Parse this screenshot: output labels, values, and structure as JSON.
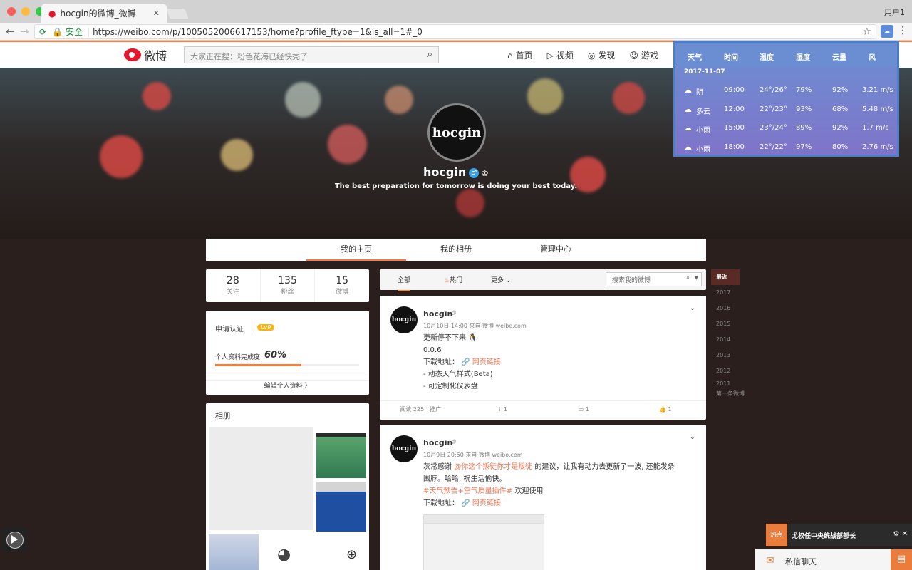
{
  "browser": {
    "tab_title": "hocgin的微博_微博",
    "user": "用户1",
    "secure_label": "安全",
    "url": "https://weibo.com/p/1005052006617153/home?profile_ftype=1&is_all=1#_0"
  },
  "weibo": {
    "logo": "微博",
    "search_placeholder": "大家正在搜：粉色花海已经快秃了",
    "nav": [
      "首页",
      "视频",
      "发现",
      "游戏"
    ]
  },
  "profile": {
    "name": "hocgin",
    "bio": "The best preparation for tomorrow is doing your best today.",
    "avatar_text": "hocgin",
    "tabs": [
      "我的主页",
      "我的相册",
      "管理中心"
    ],
    "stats": [
      {
        "value": "28",
        "label": "关注"
      },
      {
        "value": "135",
        "label": "粉丝"
      },
      {
        "value": "15",
        "label": "微博"
      }
    ],
    "cert_label": "申请认证",
    "level": "Lv9",
    "completeness_label": "个人资料完成度",
    "completeness": "60%",
    "completeness_fraction": 0.6,
    "edit_label": "编辑个人资料 〉",
    "album_title": "相册"
  },
  "feed": {
    "tabs": [
      "全部",
      "热门",
      "更多"
    ],
    "search_placeholder": "搜索我的微博",
    "posts": [
      {
        "author": "hocgin",
        "time": "10月10日 14:00 来自 微博 weibo.com",
        "lines": [
          "更新停不下来",
          "0.0.6",
          "下载地址：",
          "- 动态天气样式(Beta)",
          "- 可定制化仪表盘"
        ],
        "link": "网页链接",
        "actions": [
          "阅读 225",
          "推广",
          "1",
          "1",
          "1"
        ]
      },
      {
        "author": "hocgin",
        "time": "10月9日 20:50 来自 微博 weibo.com",
        "line1_a": "灰常感谢 ",
        "mention": "@你这个叛徒你才是叛徒",
        "line1_b": " 的建议，让我有动力去更新了一波, 还能发条",
        "line2": "围脖。哈哈, 祝生活愉快。",
        "hashtag": "#天气预告+空气质量插件#",
        "line3_b": " 欢迎使用",
        "download": "下载地址：",
        "link": "网页链接"
      }
    ]
  },
  "years": [
    "最近",
    "2017",
    "2016",
    "2015",
    "2014",
    "2013",
    "2012",
    "2011",
    "第一条微博"
  ],
  "weather": {
    "headers": [
      "天气",
      "时间",
      "温度",
      "湿度",
      "云量",
      "风"
    ],
    "date": "2017-11-07",
    "rows": [
      {
        "cond": "阴",
        "time": "09:00",
        "temp": "24°/26°",
        "humidity": "79%",
        "cloud": "92%",
        "wind": "3.21 m/s"
      },
      {
        "cond": "多云",
        "time": "12:00",
        "temp": "22°/23°",
        "humidity": "93%",
        "cloud": "68%",
        "wind": "5.48 m/s"
      },
      {
        "cond": "小雨",
        "time": "15:00",
        "temp": "23°/24°",
        "humidity": "89%",
        "cloud": "92%",
        "wind": "1.7 m/s"
      },
      {
        "cond": "小雨",
        "time": "18:00",
        "temp": "22°/22°",
        "humidity": "97%",
        "cloud": "80%",
        "wind": "2.76 m/s"
      }
    ]
  },
  "hot": {
    "tag": "热点",
    "text": "尤权任中央统战部部长"
  },
  "chat": {
    "label": "私信聊天"
  }
}
